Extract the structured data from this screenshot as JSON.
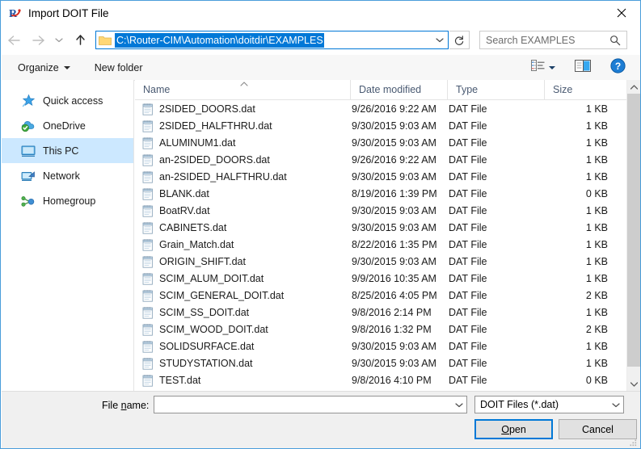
{
  "window": {
    "title": "Import DOIT File",
    "app_icon": "router-cim-logo-icon",
    "close_label": "✕",
    "accent_color": "#0078d7",
    "border_color": "#4a9ddb"
  },
  "navigation": {
    "back_label": "←",
    "forward_label": "→",
    "recent_label": "⌄",
    "up_label": "↑",
    "address_path": "C:\\Router-CIM\\Automation\\doitdir\\EXAMPLES",
    "address_selected": true,
    "refresh_label": "↻"
  },
  "search": {
    "placeholder": "Search EXAMPLES",
    "value": ""
  },
  "commandbar": {
    "organize_label": "Organize",
    "new_folder_label": "New folder",
    "view_mode_icon": "list-view-icon",
    "preview_pane_icon": "preview-pane-icon",
    "help_icon": "help-icon",
    "help_label": "?"
  },
  "sidebar": {
    "items": [
      {
        "label": "Quick access",
        "icon": "star-icon",
        "selected": false
      },
      {
        "label": "OneDrive",
        "icon": "cloud-icon",
        "selected": false
      },
      {
        "label": "This PC",
        "icon": "monitor-icon",
        "selected": true
      },
      {
        "label": "Network",
        "icon": "network-icon",
        "selected": false
      },
      {
        "label": "Homegroup",
        "icon": "homegroup-icon",
        "selected": false
      }
    ]
  },
  "filelist": {
    "columns": [
      "Name",
      "Date modified",
      "Type",
      "Size"
    ],
    "sort_column": "Name",
    "sort_direction": "ascending",
    "rows": [
      {
        "name": "2SIDED_DOORS.dat",
        "date": "9/26/2016 9:22 AM",
        "type": "DAT File",
        "size": "1 KB"
      },
      {
        "name": "2SIDED_HALFTHRU.dat",
        "date": "9/30/2015 9:03 AM",
        "type": "DAT File",
        "size": "1 KB"
      },
      {
        "name": "ALUMINUM1.dat",
        "date": "9/30/2015 9:03 AM",
        "type": "DAT File",
        "size": "1 KB"
      },
      {
        "name": "an-2SIDED_DOORS.dat",
        "date": "9/26/2016 9:22 AM",
        "type": "DAT File",
        "size": "1 KB"
      },
      {
        "name": "an-2SIDED_HALFTHRU.dat",
        "date": "9/30/2015 9:03 AM",
        "type": "DAT File",
        "size": "1 KB"
      },
      {
        "name": "BLANK.dat",
        "date": "8/19/2016 1:39 PM",
        "type": "DAT File",
        "size": "0 KB"
      },
      {
        "name": "BoatRV.dat",
        "date": "9/30/2015 9:03 AM",
        "type": "DAT File",
        "size": "1 KB"
      },
      {
        "name": "CABINETS.dat",
        "date": "9/30/2015 9:03 AM",
        "type": "DAT File",
        "size": "1 KB"
      },
      {
        "name": "Grain_Match.dat",
        "date": "8/22/2016 1:35 PM",
        "type": "DAT File",
        "size": "1 KB"
      },
      {
        "name": "ORIGIN_SHIFT.dat",
        "date": "9/30/2015 9:03 AM",
        "type": "DAT File",
        "size": "1 KB"
      },
      {
        "name": "SCIM_ALUM_DOIT.dat",
        "date": "9/9/2016 10:35 AM",
        "type": "DAT File",
        "size": "1 KB"
      },
      {
        "name": "SCIM_GENERAL_DOIT.dat",
        "date": "8/25/2016 4:05 PM",
        "type": "DAT File",
        "size": "2 KB"
      },
      {
        "name": "SCIM_SS_DOIT.dat",
        "date": "9/8/2016 2:14 PM",
        "type": "DAT File",
        "size": "1 KB"
      },
      {
        "name": "SCIM_WOOD_DOIT.dat",
        "date": "9/8/2016 1:32 PM",
        "type": "DAT File",
        "size": "2 KB"
      },
      {
        "name": "SOLIDSURFACE.dat",
        "date": "9/30/2015 9:03 AM",
        "type": "DAT File",
        "size": "1 KB"
      },
      {
        "name": "STUDYSTATION.dat",
        "date": "9/30/2015 9:03 AM",
        "type": "DAT File",
        "size": "1 KB"
      },
      {
        "name": "TEST.dat",
        "date": "9/8/2016 4:10 PM",
        "type": "DAT File",
        "size": "0 KB"
      }
    ]
  },
  "footer": {
    "filename_label_before": "File ",
    "filename_label_accel": "n",
    "filename_label_after": "ame:",
    "filename_value": "",
    "filter_value": "DOIT Files (*.dat)",
    "open_label_before": "",
    "open_label_accel": "O",
    "open_label_after": "pen",
    "cancel_label": "Cancel"
  }
}
